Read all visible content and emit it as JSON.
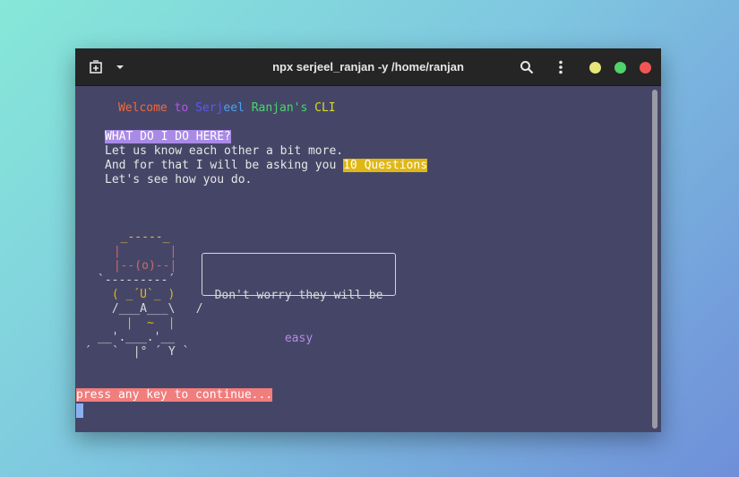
{
  "window": {
    "title": "npx serjeel_ranjan -y /home/ranjan",
    "icons": [
      "new-tab-icon",
      "chevron-down-icon",
      "search-icon",
      "kebab-menu-icon"
    ],
    "traffic_lights": [
      "#e6e67a",
      "#4fd36a",
      "#f25555"
    ]
  },
  "terminal": {
    "welcome": [
      "Welcome",
      " to ",
      "Serj",
      "eel",
      " Ranjan's",
      " CLI"
    ],
    "welcome_colors": [
      "#f2683b",
      "#b455e6",
      "#5a58f2",
      "#4aa0f2",
      "#45d96a",
      "#d9d92b"
    ],
    "intro_heading": "WHAT DO I DO HERE?",
    "intro_line1": "Let us know each other a bit more.",
    "intro_line2_prefix": "And for that I will be asking you ",
    "intro_line2_highlight": "10 Questions",
    "intro_line3": "Let's see how you do.",
    "speech_line1": "Don't worry they will be",
    "speech_line2": "easy",
    "prompt": "press any key to continue..."
  },
  "ascii_art": [
    {
      "text": "  _-----_",
      "color": "#e0c24a"
    },
    {
      "text": " |       |",
      "color": "#c96b6b"
    },
    {
      "text": " |--(o)--|",
      "color": "#c96b6b"
    },
    {
      "text": "`---------´",
      "color": "#d8d8d8"
    },
    {
      "text": " ( _´U`_ )",
      "color": "#e0b714"
    },
    {
      "text": " /___A___\\   /",
      "color": "#d8d8d8"
    },
    {
      "text": "  |  ~  |",
      "color": "#e0b714"
    },
    {
      "text": "__'.___.'__",
      "color": "#d8d8d8"
    },
    {
      "text": "´   `  |° ´ Y `",
      "color": "#d8d8d8"
    }
  ]
}
